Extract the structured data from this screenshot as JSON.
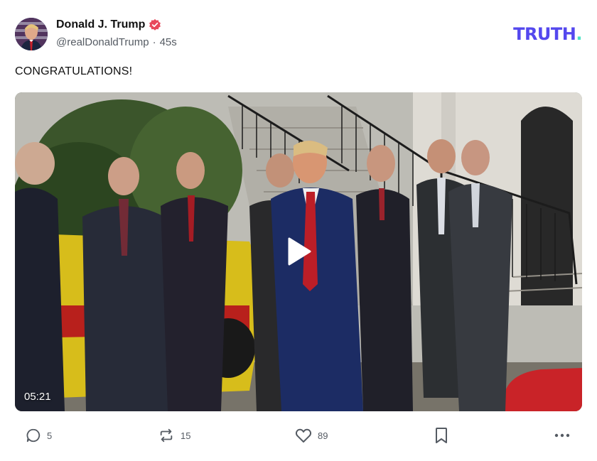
{
  "author": {
    "display_name": "Donald J. Trump",
    "handle": "@realDonaldTrump",
    "separator": "·",
    "timestamp": "45s",
    "verified_color": "#e8485b"
  },
  "brand": {
    "name": "TRUTH",
    "dot": ".",
    "primary_color": "#5448ee",
    "dot_color": "#4ce3c5"
  },
  "post": {
    "text": "CONGRATULATIONS!"
  },
  "video": {
    "duration": "05:21"
  },
  "actions": {
    "reply_count": "5",
    "retruth_count": "15",
    "like_count": "89",
    "icons": [
      "reply-icon",
      "retruth-icon",
      "like-icon",
      "bookmark-icon",
      "more-icon"
    ]
  }
}
